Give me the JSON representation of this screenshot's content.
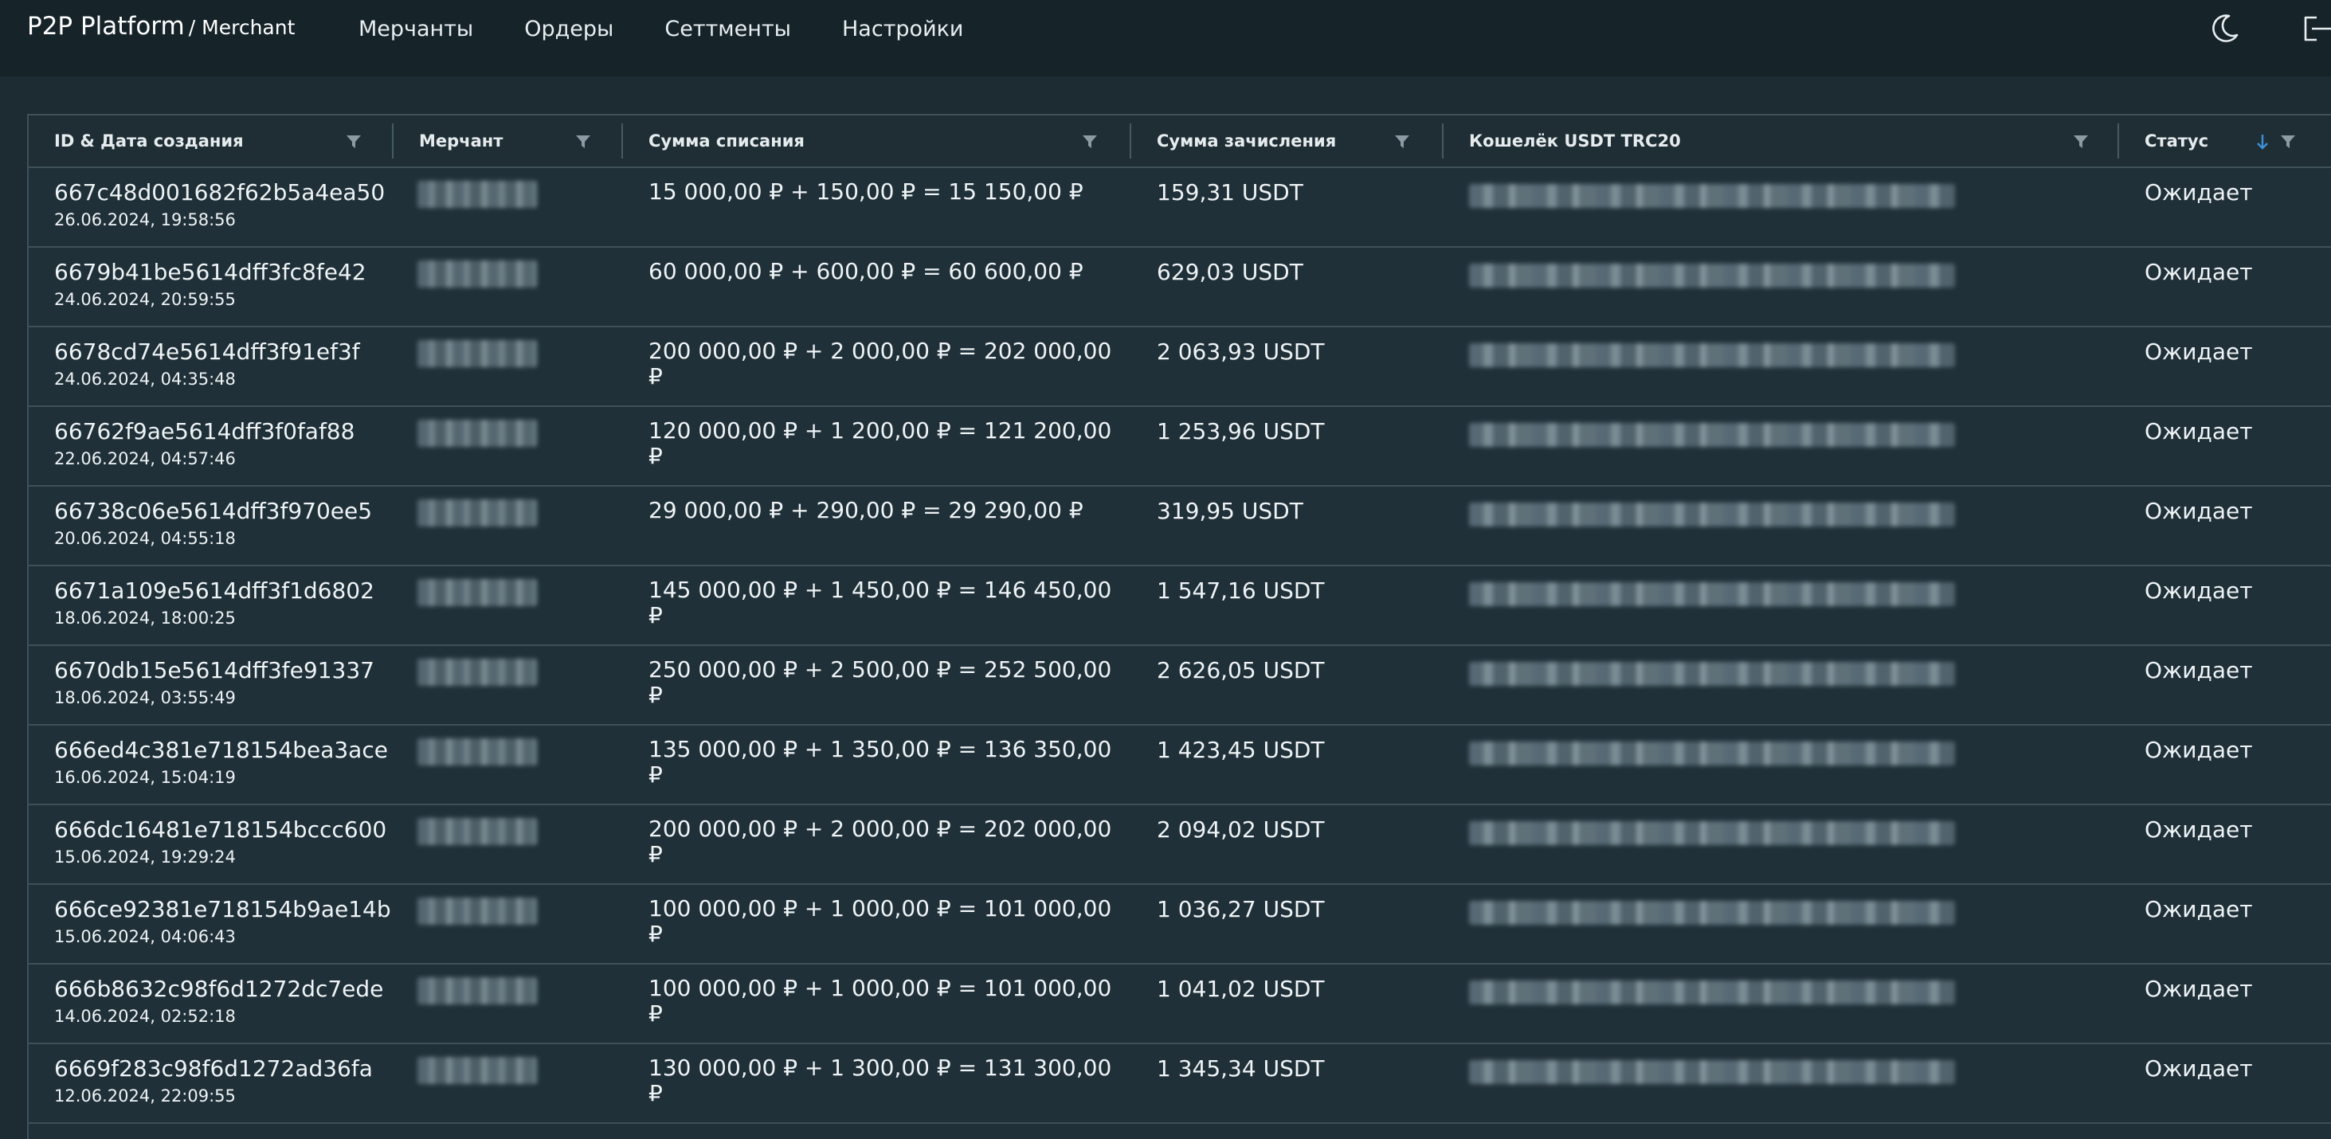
{
  "app": {
    "brand": "P2P Platform",
    "brand_sub": "/ Merchant"
  },
  "nav": {
    "items": [
      "Мерчанты",
      "Ордеры",
      "Сеттменты",
      "Настройки"
    ]
  },
  "icons": {
    "theme": "moon-icon",
    "logout": "logout-icon",
    "filter": "filter-icon",
    "sort": "sort-arrow-down-icon"
  },
  "colors": {
    "background": "#1d2c33",
    "topbar": "#16242a",
    "sort_accent": "#3d8fd6"
  },
  "table": {
    "columns": {
      "id": "ID & Дата создания",
      "merchant": "Мерчант",
      "debit": "Сумма списания",
      "credit": "Сумма зачисления",
      "wallet": "Кошелёк USDT TRC20",
      "status": "Статус"
    },
    "rows": [
      {
        "id": "667c48d001682f62b5a4ea50",
        "date": "26.06.2024, 19:58:56",
        "debit": "15 000,00 ₽ + 150,00 ₽ = 15 150,00 ₽",
        "credit": "159,31 USDT",
        "status": "Ожидает"
      },
      {
        "id": "6679b41be5614dff3fc8fe42",
        "date": "24.06.2024, 20:59:55",
        "debit": "60 000,00 ₽ + 600,00 ₽ = 60 600,00 ₽",
        "credit": "629,03 USDT",
        "status": "Ожидает"
      },
      {
        "id": "6678cd74e5614dff3f91ef3f",
        "date": "24.06.2024, 04:35:48",
        "debit": "200 000,00 ₽ + 2 000,00 ₽ = 202 000,00 ₽",
        "credit": "2 063,93 USDT",
        "status": "Ожидает"
      },
      {
        "id": "66762f9ae5614dff3f0faf88",
        "date": "22.06.2024, 04:57:46",
        "debit": "120 000,00 ₽ + 1 200,00 ₽ = 121 200,00 ₽",
        "credit": "1 253,96 USDT",
        "status": "Ожидает"
      },
      {
        "id": "66738c06e5614dff3f970ee5",
        "date": "20.06.2024, 04:55:18",
        "debit": "29 000,00 ₽ + 290,00 ₽ = 29 290,00 ₽",
        "credit": "319,95 USDT",
        "status": "Ожидает"
      },
      {
        "id": "6671a109e5614dff3f1d6802",
        "date": "18.06.2024, 18:00:25",
        "debit": "145 000,00 ₽ + 1 450,00 ₽ = 146 450,00 ₽",
        "credit": "1 547,16 USDT",
        "status": "Ожидает"
      },
      {
        "id": "6670db15e5614dff3fe91337",
        "date": "18.06.2024, 03:55:49",
        "debit": "250 000,00 ₽ + 2 500,00 ₽ = 252 500,00 ₽",
        "credit": "2 626,05 USDT",
        "status": "Ожидает"
      },
      {
        "id": "666ed4c381e718154bea3ace",
        "date": "16.06.2024, 15:04:19",
        "debit": "135 000,00 ₽ + 1 350,00 ₽ = 136 350,00 ₽",
        "credit": "1 423,45 USDT",
        "status": "Ожидает"
      },
      {
        "id": "666dc16481e718154bccc600",
        "date": "15.06.2024, 19:29:24",
        "debit": "200 000,00 ₽ + 2 000,00 ₽ = 202 000,00 ₽",
        "credit": "2 094,02 USDT",
        "status": "Ожидает"
      },
      {
        "id": "666ce92381e718154b9ae14b",
        "date": "15.06.2024, 04:06:43",
        "debit": "100 000,00 ₽ + 1 000,00 ₽ = 101 000,00 ₽",
        "credit": "1 036,27 USDT",
        "status": "Ожидает"
      },
      {
        "id": "666b8632c98f6d1272dc7ede",
        "date": "14.06.2024, 02:52:18",
        "debit": "100 000,00 ₽ + 1 000,00 ₽ = 101 000,00 ₽",
        "credit": "1 041,02 USDT",
        "status": "Ожидает"
      },
      {
        "id": "6669f283c98f6d1272ad36fa",
        "date": "12.06.2024, 22:09:55",
        "debit": "130 000,00 ₽ + 1 300,00 ₽ = 131 300,00 ₽",
        "credit": "1 345,34 USDT",
        "status": "Ожидает"
      }
    ]
  }
}
